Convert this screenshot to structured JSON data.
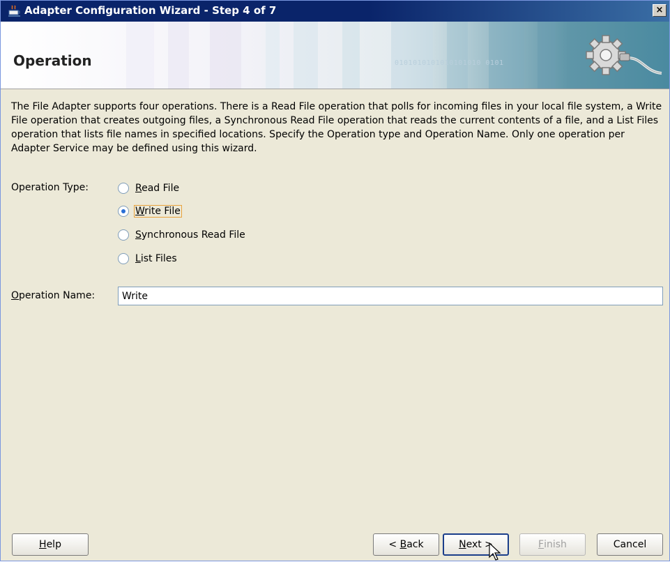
{
  "window": {
    "title": "Adapter Configuration Wizard - Step 4 of 7",
    "close_glyph": "×"
  },
  "banner": {
    "heading": "Operation",
    "binary_text": "0101010101010101010 0101"
  },
  "description": "The File Adapter supports four operations.  There is a Read File operation that polls for incoming files in your local file system, a Write File operation that creates outgoing files, a Synchronous Read File operation that reads the current contents of a file, and a List Files operation that lists file names in specified locations.  Specify the Operation type and Operation Name.  Only one operation per Adapter Service may be defined using this wizard.",
  "operation_type": {
    "label": "Operation Type:",
    "options": [
      {
        "mnemonic": "R",
        "rest": "ead File",
        "checked": false
      },
      {
        "mnemonic": "W",
        "rest": "rite File",
        "checked": true
      },
      {
        "mnemonic": "S",
        "rest": "ynchronous Read File",
        "checked": false
      },
      {
        "mnemonic": "L",
        "rest": "ist Files",
        "checked": false
      }
    ],
    "selected": "Write File"
  },
  "operation_name": {
    "label_mnemonic": "O",
    "label_rest": "peration Name:",
    "value": "Write"
  },
  "buttons": {
    "help": {
      "mnemonic": "H",
      "rest": "elp"
    },
    "back": {
      "prefix": "< ",
      "mnemonic": "B",
      "rest": "ack"
    },
    "next": {
      "mnemonic": "N",
      "rest": "ext >"
    },
    "finish": {
      "mnemonic": "F",
      "rest": "inish"
    },
    "cancel": "Cancel"
  },
  "colors": {
    "title_bar": "#0a246a",
    "dialog_bg": "#ece9d8",
    "radio_dot": "#2a6fd6",
    "focus_ring": "#e8a23c"
  },
  "icons": {
    "title": "coffee-cup-icon",
    "banner": "gear-plug-icon"
  }
}
